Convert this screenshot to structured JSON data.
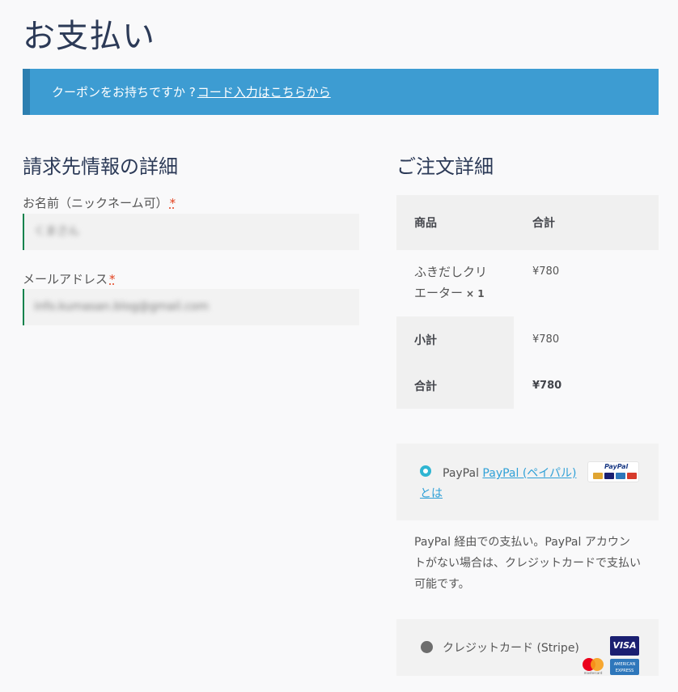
{
  "page": {
    "title": "お支払い"
  },
  "coupon": {
    "text": "クーポンをお持ちですか ?",
    "link": "コード入力はこちらから"
  },
  "billing": {
    "heading": "請求先情報の詳細",
    "fields": [
      {
        "label": "お名前（ニックネーム可）",
        "required": "*",
        "value": "くまさん"
      },
      {
        "label": "メールアドレス",
        "required": "*",
        "value": "info.kumasan.blog@gmail.com"
      }
    ]
  },
  "order": {
    "heading": "ご注文詳細",
    "col_product": "商品",
    "col_total": "合計",
    "item": {
      "name_line1": "ふきだしクリ",
      "name_line2": "エーター",
      "qty": "× 1",
      "price": "¥780"
    },
    "subtotal_label": "小計",
    "subtotal_value": "¥780",
    "total_label": "合計",
    "total_value": "¥780"
  },
  "payment": {
    "paypal": {
      "label": "PayPal",
      "link_line1": "PayPal (ペイパル)",
      "link_line2": "とは",
      "logo_text": "PayPal"
    },
    "paypal_desc": "PayPal 経由での支払い。PayPal アカウントがない場合は、クレジットカードで支払い可能です。",
    "card": {
      "label": "クレジットカード (Stripe)",
      "visa": "VISA",
      "amex": "AMERICAN EXPRESS",
      "mastercard": "mastercard"
    }
  },
  "colors": {
    "coupon_bg": "#3d9cd2",
    "accent_green": "#0f834d",
    "radio_active": "#2fb5d2",
    "link": "#2fa0d7"
  }
}
